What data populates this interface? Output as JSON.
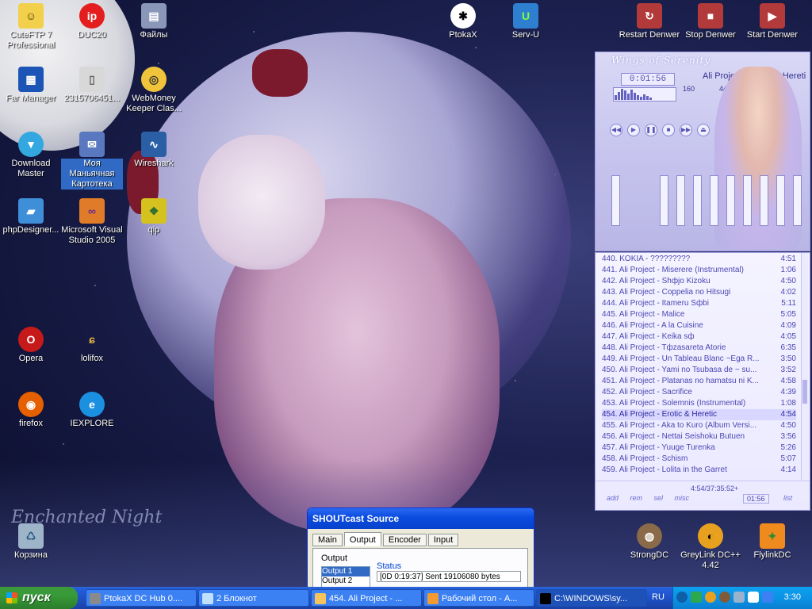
{
  "desktop": {
    "icons": [
      {
        "label": "CuteFTP 7 Professional",
        "name": "cuteftp-icon"
      },
      {
        "label": "DUC20",
        "name": "duc20-icon"
      },
      {
        "label": "Файлы",
        "name": "files-icon"
      },
      {
        "label": "PtokaX",
        "name": "ptokax-icon"
      },
      {
        "label": "Serv-U",
        "name": "servu-icon"
      },
      {
        "label": "Restart Denwer",
        "name": "restart-denwer-icon"
      },
      {
        "label": "Stop Denwer",
        "name": "stop-denwer-icon"
      },
      {
        "label": "Start Denwer",
        "name": "start-denwer-icon"
      },
      {
        "label": "Far Manager",
        "name": "far-manager-icon"
      },
      {
        "label": "2315706451...",
        "name": "file-2315706451-icon"
      },
      {
        "label": "WebMoney Keeper Clas...",
        "name": "webmoney-icon"
      },
      {
        "label": "Download Master",
        "name": "download-master-icon"
      },
      {
        "label": "Моя Маньячная Картотека",
        "name": "kartoteka-icon"
      },
      {
        "label": "Wireshark",
        "name": "wireshark-icon"
      },
      {
        "label": "phpDesigner...",
        "name": "phpdesigner-icon"
      },
      {
        "label": "Microsoft Visual Studio 2005",
        "name": "visual-studio-icon"
      },
      {
        "label": "qip",
        "name": "qip-icon"
      },
      {
        "label": "Opera",
        "name": "opera-icon"
      },
      {
        "label": "lolifox",
        "name": "lolifox-icon"
      },
      {
        "label": "firefox",
        "name": "firefox-icon"
      },
      {
        "label": "IEXPLORE",
        "name": "iexplore-icon"
      },
      {
        "label": "Корзина",
        "name": "recycle-bin-icon"
      },
      {
        "label": "StrongDC",
        "name": "strongdc-icon"
      },
      {
        "label": "GreyLink DC++ 4.42",
        "name": "greylink-icon"
      },
      {
        "label": "FlylinkDC",
        "name": "flylinkdc-icon"
      }
    ],
    "wallpaper_text": "Enchanted Night"
  },
  "player": {
    "skin_title": "Wings of Serenity",
    "time": "0:01:56",
    "song": "Ali Project - Erotic & Heretic (4:5",
    "kbps": "160",
    "khz": "44"
  },
  "playlist": {
    "rows": [
      {
        "title": "440. KOKIA - ?????????",
        "dur": "4:51"
      },
      {
        "title": "441. Ali Project - Miserere (Instrumental)",
        "dur": "1:06"
      },
      {
        "title": "442. Ali Project - Shфjo Kizoku",
        "dur": "4:50"
      },
      {
        "title": "443. Ali Project - Coppelia no Hitsugi",
        "dur": "4:02"
      },
      {
        "title": "444. Ali Project - Itameru Sфbi",
        "dur": "5:11"
      },
      {
        "title": "445. Ali Project - Malice",
        "dur": "5:05"
      },
      {
        "title": "446. Ali Project - A la Cuisine",
        "dur": "4:09"
      },
      {
        "title": "447. Ali Project - Keika sф",
        "dur": "4:05"
      },
      {
        "title": "448. Ali Project - Tфzasareta Atorie",
        "dur": "6:35"
      },
      {
        "title": "449. Ali Project - Un Tableau Blanc ~Ega R...",
        "dur": "3:50"
      },
      {
        "title": "450. Ali Project - Yami no Tsubasa de ~ su...",
        "dur": "3:52"
      },
      {
        "title": "451. Ali Project - Platanas no hamatsu ni K...",
        "dur": "4:58"
      },
      {
        "title": "452. Ali Project - Sacrifice",
        "dur": "4:39"
      },
      {
        "title": "453. Ali Project - Solemnis (Instrumental)",
        "dur": "1:08"
      },
      {
        "title": "454. Ali Project - Erotic & Heretic",
        "dur": "4:54"
      },
      {
        "title": "455. Ali Project - Aka to Kuro (Album Versi...",
        "dur": "4:50"
      },
      {
        "title": "456. Ali Project - Nettai Seishoku Butuen",
        "dur": "3:56"
      },
      {
        "title": "457. Ali Project - Yuuge Turenka",
        "dur": "5:26"
      },
      {
        "title": "458. Ali Project - Schism",
        "dur": "5:07"
      },
      {
        "title": "459. Ali Project - Lolita in the Garret",
        "dur": "4:14"
      }
    ],
    "current_index": 14,
    "footer_buttons": "add rem sel misc",
    "total": "4:54/37:35:52+",
    "pos": "01:56",
    "list_button": "list"
  },
  "shoutcast": {
    "title": "SHOUTcast Source",
    "tabs": [
      "Main",
      "Output",
      "Encoder",
      "Input"
    ],
    "active_tab": "Output",
    "output_label": "Output",
    "outputs": [
      "Output 1",
      "Output 2"
    ],
    "status_label": "Status",
    "status_value": "[0D 0:19:37] Sent 19106080 bytes"
  },
  "taskbar": {
    "start_label": "пуск",
    "tasks": [
      {
        "label": "PtokaX DC Hub 0....",
        "color": "#8a8a8a"
      },
      {
        "label": "2 Блокнот",
        "color": "#bfe0ff"
      },
      {
        "label": "454. Ali Project - ...",
        "color": "#f7c35d"
      },
      {
        "label": "Рабочий стол - A...",
        "color": "#f39a33"
      },
      {
        "label": "C:\\WINDOWS\\sy...",
        "color": "#000000"
      }
    ],
    "language": "RU",
    "clock": "3:30"
  }
}
